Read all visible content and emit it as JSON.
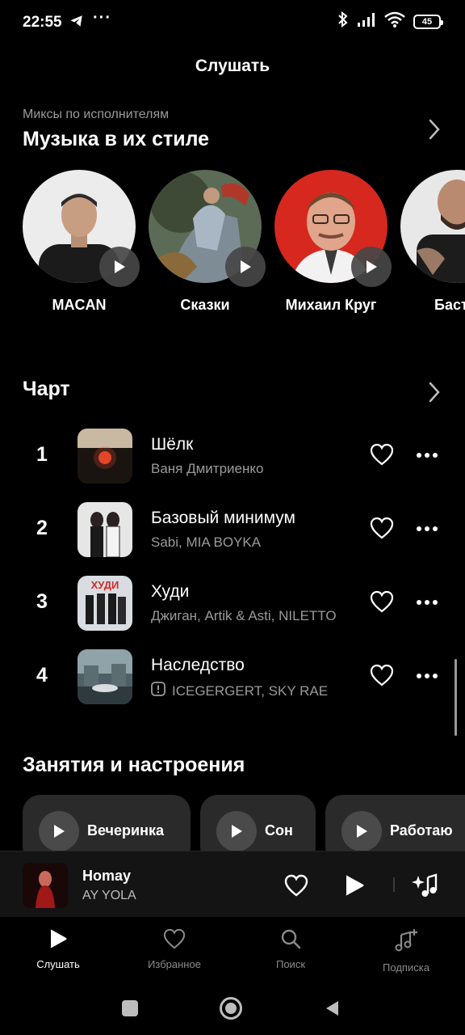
{
  "status_bar": {
    "time": "22:55",
    "dots": "···",
    "battery": "45"
  },
  "page": {
    "title": "Слушать"
  },
  "artist_mixes": {
    "subtitle": "Миксы по исполнителям",
    "title": "Музыка в их стиле",
    "artists": [
      {
        "name": "MACAN"
      },
      {
        "name": "Сказки"
      },
      {
        "name": "Михаил Круг"
      },
      {
        "name": "Баст"
      }
    ]
  },
  "chart": {
    "title": "Чарт",
    "tracks": [
      {
        "rank": "1",
        "title": "Шёлк",
        "artist": "Ваня Дмитриенко",
        "explicit": false
      },
      {
        "rank": "2",
        "title": "Базовый минимум",
        "artist": "Sabi, MIA BOYKA",
        "explicit": false
      },
      {
        "rank": "3",
        "title": "Худи",
        "artist": "Джиган, Artik & Asti, NILETTO",
        "explicit": false,
        "cover_text": "ХУДИ"
      },
      {
        "rank": "4",
        "title": "Наследство",
        "artist": "ICEGERGERT, SKY RAE",
        "explicit": true
      }
    ]
  },
  "moods": {
    "title": "Занятия и настроения",
    "items": [
      {
        "label": "Вечеринка"
      },
      {
        "label": "Сон"
      },
      {
        "label": "Работаю"
      }
    ]
  },
  "mini_player": {
    "title": "Homay",
    "artist": "AY YOLA"
  },
  "bottom_nav": [
    {
      "label": "Слушать",
      "icon": "play-icon",
      "active": true
    },
    {
      "label": "Избранное",
      "icon": "heart-icon",
      "active": false
    },
    {
      "label": "Поиск",
      "icon": "search-icon",
      "active": false
    },
    {
      "label": "Подписка",
      "icon": "music-plus-icon",
      "active": false
    }
  ],
  "colors": {
    "background": "#000000",
    "secondary_text": "#9a9a9a",
    "chip": "#2a2a2a"
  }
}
